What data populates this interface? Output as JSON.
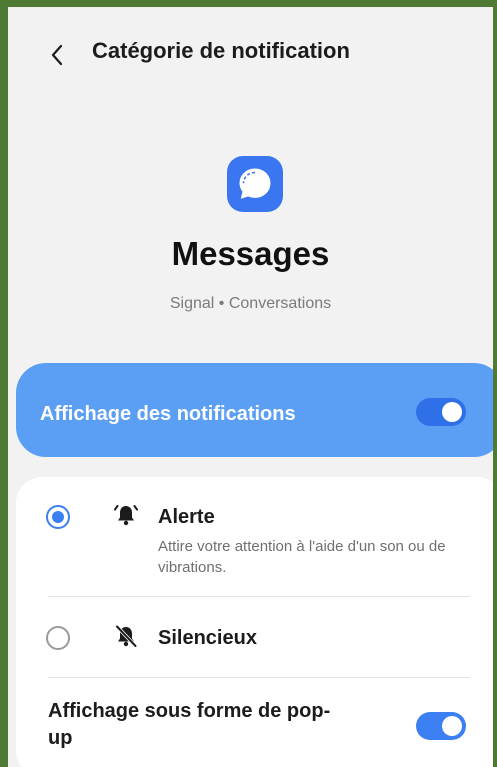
{
  "header": {
    "back_icon": "chevron-left-icon",
    "title": "Catégorie de notification"
  },
  "app": {
    "icon": "signal-chat-bubble-icon",
    "name": "Messages",
    "subtitle": "Signal • Conversations",
    "brand_color": "#3a76f0"
  },
  "master_toggle": {
    "label": "Affichage des notifications",
    "on": true,
    "row_color": "#5b9ff5"
  },
  "options": [
    {
      "selected": true,
      "icon": "bell-ringing-icon",
      "title": "Alerte",
      "description": "Attire votre attention à l'aide d'un son ou de vibrations."
    },
    {
      "selected": false,
      "icon": "bell-off-icon",
      "title": "Silencieux"
    }
  ],
  "popup_toggle": {
    "label": "Affichage sous forme de pop-up",
    "on": true
  },
  "colors": {
    "accent": "#3c7ff2",
    "background": "#f2f2f2",
    "frame": "#4f7a34"
  }
}
